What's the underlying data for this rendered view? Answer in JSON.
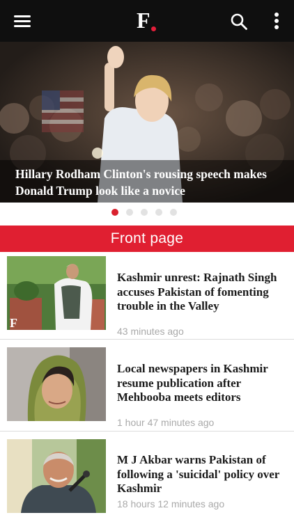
{
  "header": {
    "logo_letter": "F",
    "icons": [
      "menu-icon",
      "search-icon",
      "more-vertical-icon"
    ],
    "accent_color": "#e01f31"
  },
  "hero": {
    "title": "Hillary Rodham Clinton's rousing speech makes Donald Trump look like a novice",
    "slide_count": 5,
    "active_slide": 1
  },
  "section": {
    "title": "Front page"
  },
  "articles": [
    {
      "headline": "Kashmir unrest: Rajnath Singh accuses Pakistan of fomenting trouble in the Valley",
      "time": "43 minutes ago",
      "thumb_watermark": "F"
    },
    {
      "headline": "Local newspapers in Kashmir resume publication after Mehbooba meets editors",
      "time": "1 hour 47 minutes ago"
    },
    {
      "headline": "M J Akbar warns Pakistan of following a 'suicidal' policy over Kashmir",
      "time": "18 hours 12 minutes ago"
    }
  ]
}
